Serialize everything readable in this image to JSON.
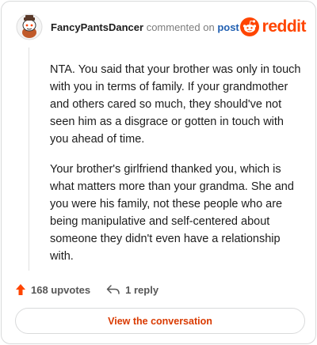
{
  "comment": {
    "username": "FancyPantsDancer",
    "action_text": "commented on",
    "post_link": "post",
    "paragraphs": [
      "NTA. You said that your brother was only in touch with you in terms of family. If your grandmother and others cared so much, they should've not seen him as a disgrace or gotten in touch with you ahead of time.",
      "Your brother's girlfriend thanked you, which is what matters more than your grandma. She and you were his family, not these people who are being manipulative and self-centered about someone they didn't even have a relationship with."
    ]
  },
  "brand": {
    "name": "reddit",
    "color": "#ff4500",
    "icon": "reddit-snoo-icon"
  },
  "stats": {
    "upvotes": "168 upvotes",
    "replies": "1 reply",
    "upvote_icon": "upvote-arrow-icon",
    "reply_icon": "reply-arrow-icon"
  },
  "cta": {
    "label": "View the conversation",
    "color": "#d93a00"
  }
}
